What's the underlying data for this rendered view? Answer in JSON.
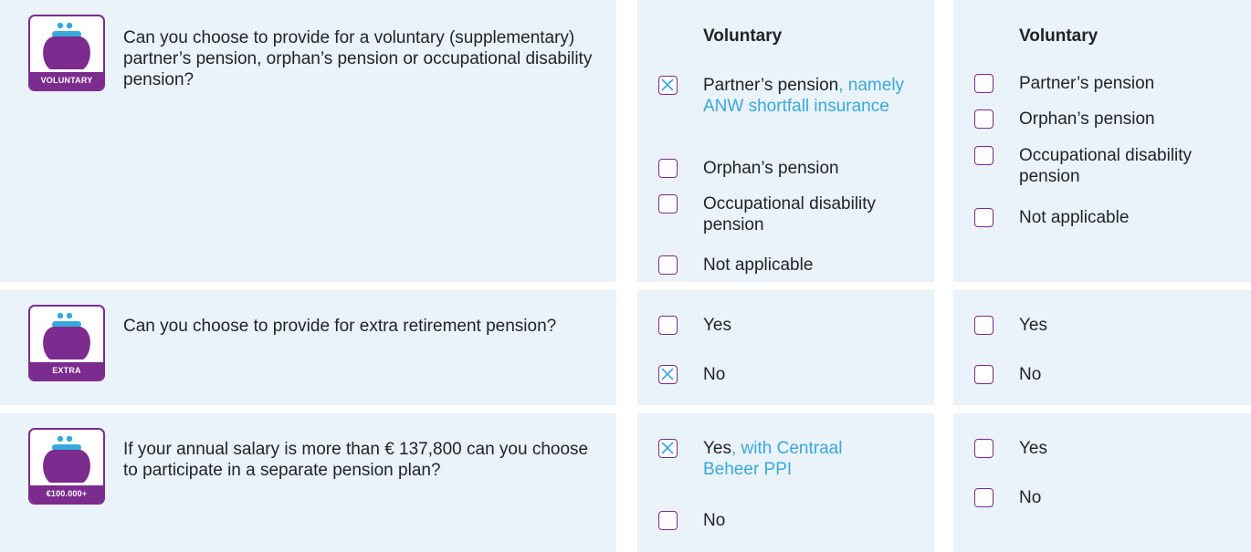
{
  "colors": {
    "panel_bg": "#eaf2fa",
    "purple": "#7b2c8e",
    "note_blue": "#38a9dc",
    "text": "#222428"
  },
  "rows": [
    {
      "icon": {
        "name": "purse-icon",
        "label": "VOLUNTARY"
      },
      "question": "Can you choose to provide for a voluntary (supplementary) partner’s pension, orphan’s pension or occupational disability pension?",
      "col1": {
        "heading": "Voluntary",
        "options": [
          {
            "label": "Partner’s pension",
            "note": ", namely ANW shortfall insurance",
            "checked": true
          },
          {
            "label": "Orphan’s pension",
            "note": "",
            "checked": false
          },
          {
            "label": "Occupational disability pension",
            "note": "",
            "checked": false
          },
          {
            "label": "Not applicable",
            "note": "",
            "checked": false
          }
        ]
      },
      "col2": {
        "heading": "Voluntary",
        "options": [
          {
            "label": "Partner’s pension",
            "note": "",
            "checked": false
          },
          {
            "label": "Orphan’s pension",
            "note": "",
            "checked": false
          },
          {
            "label": "Occupational disability pension",
            "note": "",
            "checked": false
          },
          {
            "label": "Not applicable",
            "note": "",
            "checked": false
          }
        ]
      }
    },
    {
      "icon": {
        "name": "purse-icon",
        "label": "EXTRA"
      },
      "question": "Can you choose to provide for extra retirement pension?",
      "col1": {
        "options": [
          {
            "label": "Yes",
            "note": "",
            "checked": false
          },
          {
            "label": "No",
            "note": "",
            "checked": true
          }
        ]
      },
      "col2": {
        "options": [
          {
            "label": "Yes",
            "note": "",
            "checked": false
          },
          {
            "label": "No",
            "note": "",
            "checked": false
          }
        ]
      }
    },
    {
      "icon": {
        "name": "purse-icon",
        "label": "€100.000+"
      },
      "question": "If your annual salary is more than € 137,800 can you choose to participate in a separate pension plan?",
      "col1": {
        "options": [
          {
            "label": "Yes",
            "note": ", with Centraal Beheer PPI",
            "checked": true
          },
          {
            "label": "No",
            "note": "",
            "checked": false
          }
        ]
      },
      "col2": {
        "options": [
          {
            "label": "Yes",
            "note": "",
            "checked": false
          },
          {
            "label": "No",
            "note": "",
            "checked": false
          }
        ]
      }
    }
  ]
}
